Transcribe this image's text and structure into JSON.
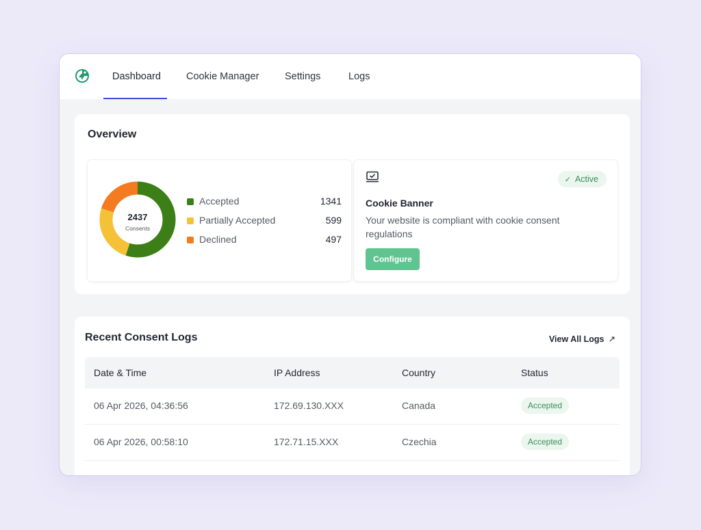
{
  "nav": {
    "logo_icon": "cookie-logo-icon",
    "tabs": [
      {
        "label": "Dashboard",
        "active": true
      },
      {
        "label": "Cookie Manager",
        "active": false
      },
      {
        "label": "Settings",
        "active": false
      },
      {
        "label": "Logs",
        "active": false
      }
    ]
  },
  "overview": {
    "title": "Overview",
    "total": "2437",
    "total_label": "Consents",
    "legend": [
      {
        "label": "Accepted",
        "value": "1341",
        "color": "#3d7f17"
      },
      {
        "label": "Partially Accepted",
        "value": "599",
        "color": "#f5c137"
      },
      {
        "label": "Declined",
        "value": "497",
        "color": "#f47b20"
      }
    ],
    "banner": {
      "icon": "monitor-check-icon",
      "status": "Active",
      "title": "Cookie Banner",
      "description": "Your website is compliant with cookie consent regulations",
      "button": "Configure"
    }
  },
  "logs": {
    "title": "Recent Consent Logs",
    "view_all": "View All Logs",
    "view_all_icon": "arrow-up-right-icon",
    "columns": [
      "Date & Time",
      "IP Address",
      "Country",
      "Status"
    ],
    "rows": [
      {
        "date": "06 Apr 2026, 04:36:56",
        "ip": "172.69.130.XXX",
        "country": "Canada",
        "status": "Accepted"
      },
      {
        "date": "06 Apr 2026, 00:58:10",
        "ip": "172.71.15.XXX",
        "country": "Czechia",
        "status": "Accepted"
      }
    ]
  },
  "colors": {
    "accent": "#3e4fd1",
    "success": "#5fc490",
    "background": "#eceaf9"
  }
}
